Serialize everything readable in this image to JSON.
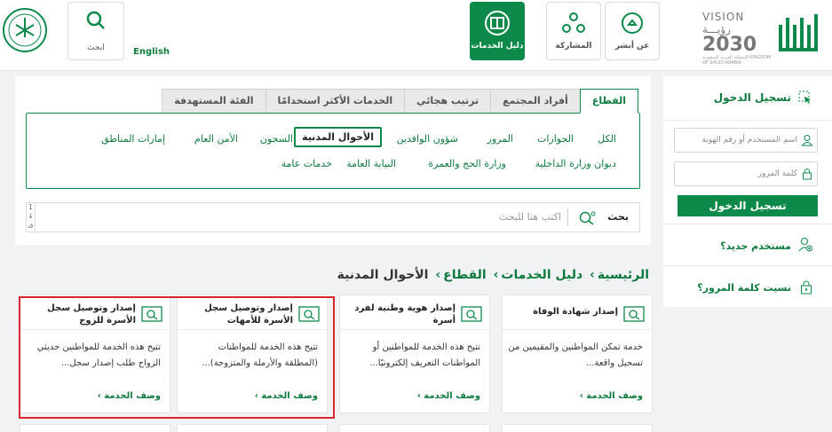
{
  "header": {
    "nav": [
      {
        "label": "عن أبشر",
        "icon": "absher-about-icon"
      },
      {
        "label": "المشاركة",
        "icon": "participation-icon"
      },
      {
        "label": "دليل الخدمات",
        "icon": "services-guide-icon"
      }
    ],
    "search_label": "ابحث",
    "english_label": "English",
    "vision": {
      "line1": "VISION رؤيـــة",
      "line2": "2030",
      "line3": "المملكة العربية السعودية KINGDOM OF SAUDI ARABIA"
    },
    "brand_color": "#0d8a4a"
  },
  "login": {
    "title": "تسجيل الدخول",
    "username_placeholder": "اسم المستخدم أو رقم الهوية",
    "password_placeholder": "كلمة المرور",
    "submit": "تسجيل الدخول",
    "new_user": "مستخدم جديد؟",
    "forgot": "نسيت كلمة المرور؟"
  },
  "filter": {
    "tabs": [
      "القطاع",
      "أفراد المجتمع",
      "ترتيب هجائي",
      "الخدمات الأكثر استخدامًا",
      "الفئة المستهدفة"
    ],
    "categories_row1": [
      "الكل",
      "الجوازات",
      "المرور",
      "شؤون الوافدين",
      "الأحوال المدنية",
      "السجون",
      "الأمن العام",
      "إمارات المناطق"
    ],
    "categories_row2": [
      "ديوان وزارة الداخلية",
      "وزارة الحج والعمرة",
      "النيابة العامة",
      "خدمات عامة"
    ],
    "search_label": "بحث",
    "search_placeholder": "اكتب هنا للبحث",
    "scroll_text": "1 ↓ ى"
  },
  "breadcrumb": [
    "الرئيسية",
    "دليل الخدمات",
    "القطاع",
    "الأحوال المدنية"
  ],
  "cards": [
    {
      "title": "إصدار شهادة الوفاة",
      "desc": "خدمة تمكن المواطنين والمقيمين من تسجيل واقعة...",
      "more": "وصف الخدمة ›"
    },
    {
      "title": "إصدار هوية وطنية لفرد أسرة",
      "desc": "تتيح هذه الخدمة للمواطنين أو المواطنات التعريف إلكترونيًا...",
      "more": "وصف الخدمة ›"
    },
    {
      "title": "إصدار وتوصيل سجل الأسرة للأمهات",
      "desc": "تتيح هذه الخدمة للمواطنات (المطلقة والأرملة والمتزوجة)...",
      "more": "وصف الخدمة ›"
    },
    {
      "title": "إصدار وتوصيل سجل الأسرة للزوج",
      "desc": "تتيح هذه الخدمة للمواطنين حديثي الزواج طلب إصدار سجل...",
      "more": "وصف الخدمة ›"
    }
  ]
}
